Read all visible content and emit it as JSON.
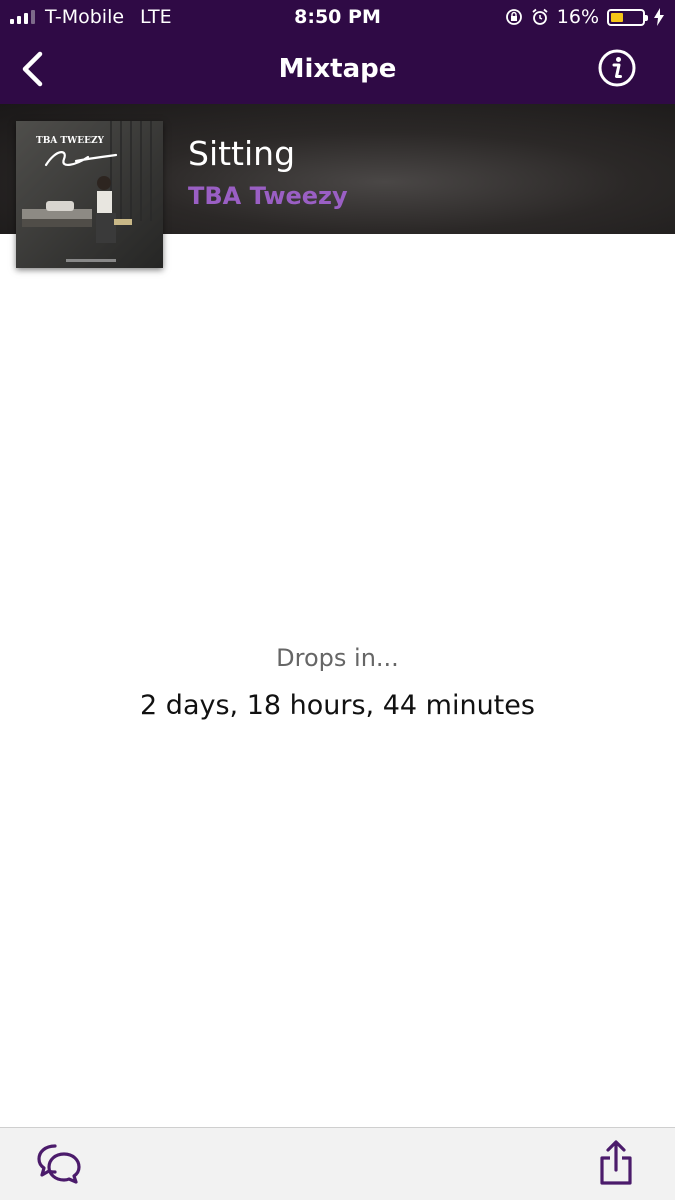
{
  "status_bar": {
    "carrier": "T-Mobile",
    "network": "LTE",
    "time": "8:50 PM",
    "battery": "16%",
    "battery_level": 0.16,
    "icons": [
      "signal-icon",
      "orientation-lock-icon",
      "alarm-icon",
      "battery-icon",
      "charging-icon"
    ]
  },
  "nav": {
    "title": "Mixtape",
    "back_icon": "chevron-left-icon",
    "info_icon": "info-icon"
  },
  "release": {
    "title": "Sitting",
    "artist": "TBA Tweezy",
    "cover_text": "TBA TWEEZY"
  },
  "countdown": {
    "label": "Drops in...",
    "value": "2 days, 18 hours, 44 minutes"
  },
  "toolbar": {
    "chat_icon": "chat-bubbles-icon",
    "share_icon": "share-icon"
  },
  "colors": {
    "bar": "#2f0a45",
    "accent": "#9a5fc4"
  }
}
